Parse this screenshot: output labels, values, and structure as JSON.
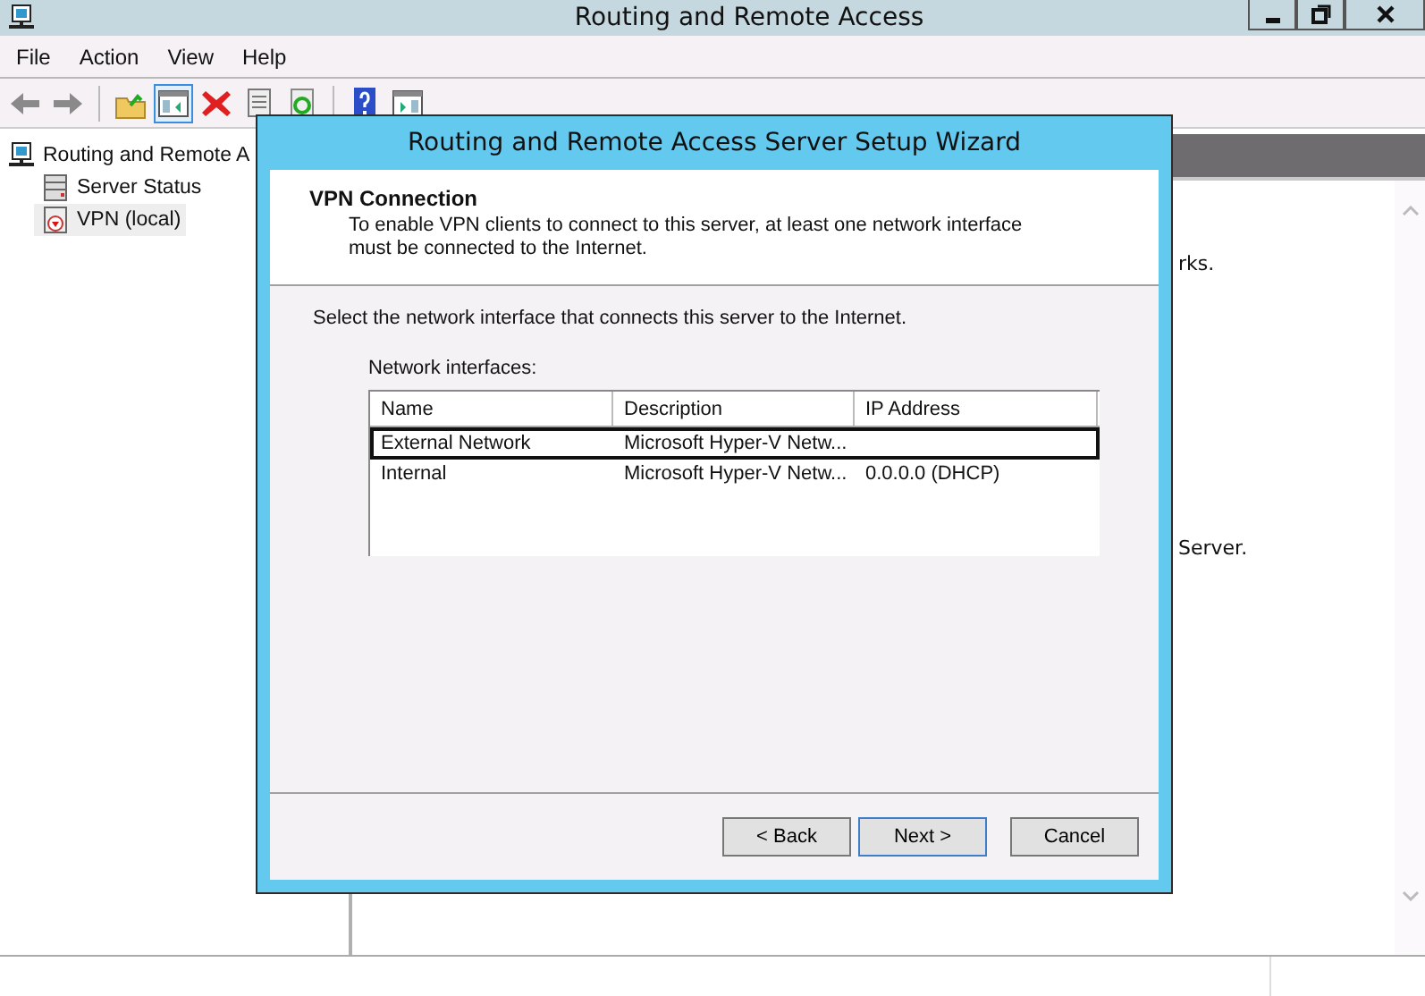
{
  "window": {
    "title": "Routing and Remote Access"
  },
  "menu": [
    {
      "label": "File"
    },
    {
      "label": "Action"
    },
    {
      "label": "View"
    },
    {
      "label": "Help"
    }
  ],
  "toolbar": [
    {
      "kind": "back",
      "selected": false
    },
    {
      "kind": "forward",
      "selected": false
    },
    {
      "kind": "up",
      "selected": false
    },
    {
      "kind": "tree",
      "selected": true
    },
    {
      "kind": "delete",
      "selected": false
    },
    {
      "kind": "properties",
      "selected": false
    },
    {
      "kind": "refresh",
      "selected": false
    },
    {
      "kind": "help",
      "selected": false
    },
    {
      "kind": "pane",
      "selected": false
    }
  ],
  "tree": {
    "items": [
      {
        "label": "Routing and Remote A",
        "kind": "server",
        "selected": false,
        "children": [
          {
            "label": "Server Status",
            "kind": "status",
            "selected": false
          },
          {
            "label": "VPN (local)",
            "kind": "vpn",
            "selected": true
          }
        ]
      }
    ]
  },
  "details": {
    "lines": [
      "rks.",
      "Server."
    ]
  },
  "dialog": {
    "title": "Routing and Remote Access Server Setup Wizard",
    "heading": "VPN Connection",
    "subtitle_lines": [
      "To enable VPN clients to connect to this server, at least one network interface",
      "must be connected to the Internet."
    ],
    "instruction": "Select the network interface that connects this server to the Internet.",
    "list_label": "Network interfaces:",
    "columns": [
      "Name",
      "Description",
      "IP Address"
    ],
    "rows": [
      {
        "cells": [
          "External Network",
          "Microsoft Hyper-V Netw..."
        ],
        "selected": true
      },
      {
        "cells": [
          "Internal",
          "Microsoft Hyper-V Netw...",
          "0.0.0.0 (DHCP)"
        ],
        "selected": false
      }
    ],
    "buttons": [
      {
        "label": "< Back",
        "kind": "back",
        "default": false
      },
      {
        "label": "Next >",
        "kind": "next",
        "default": true
      },
      {
        "label": "Cancel",
        "kind": "cancel",
        "default": false
      }
    ]
  }
}
